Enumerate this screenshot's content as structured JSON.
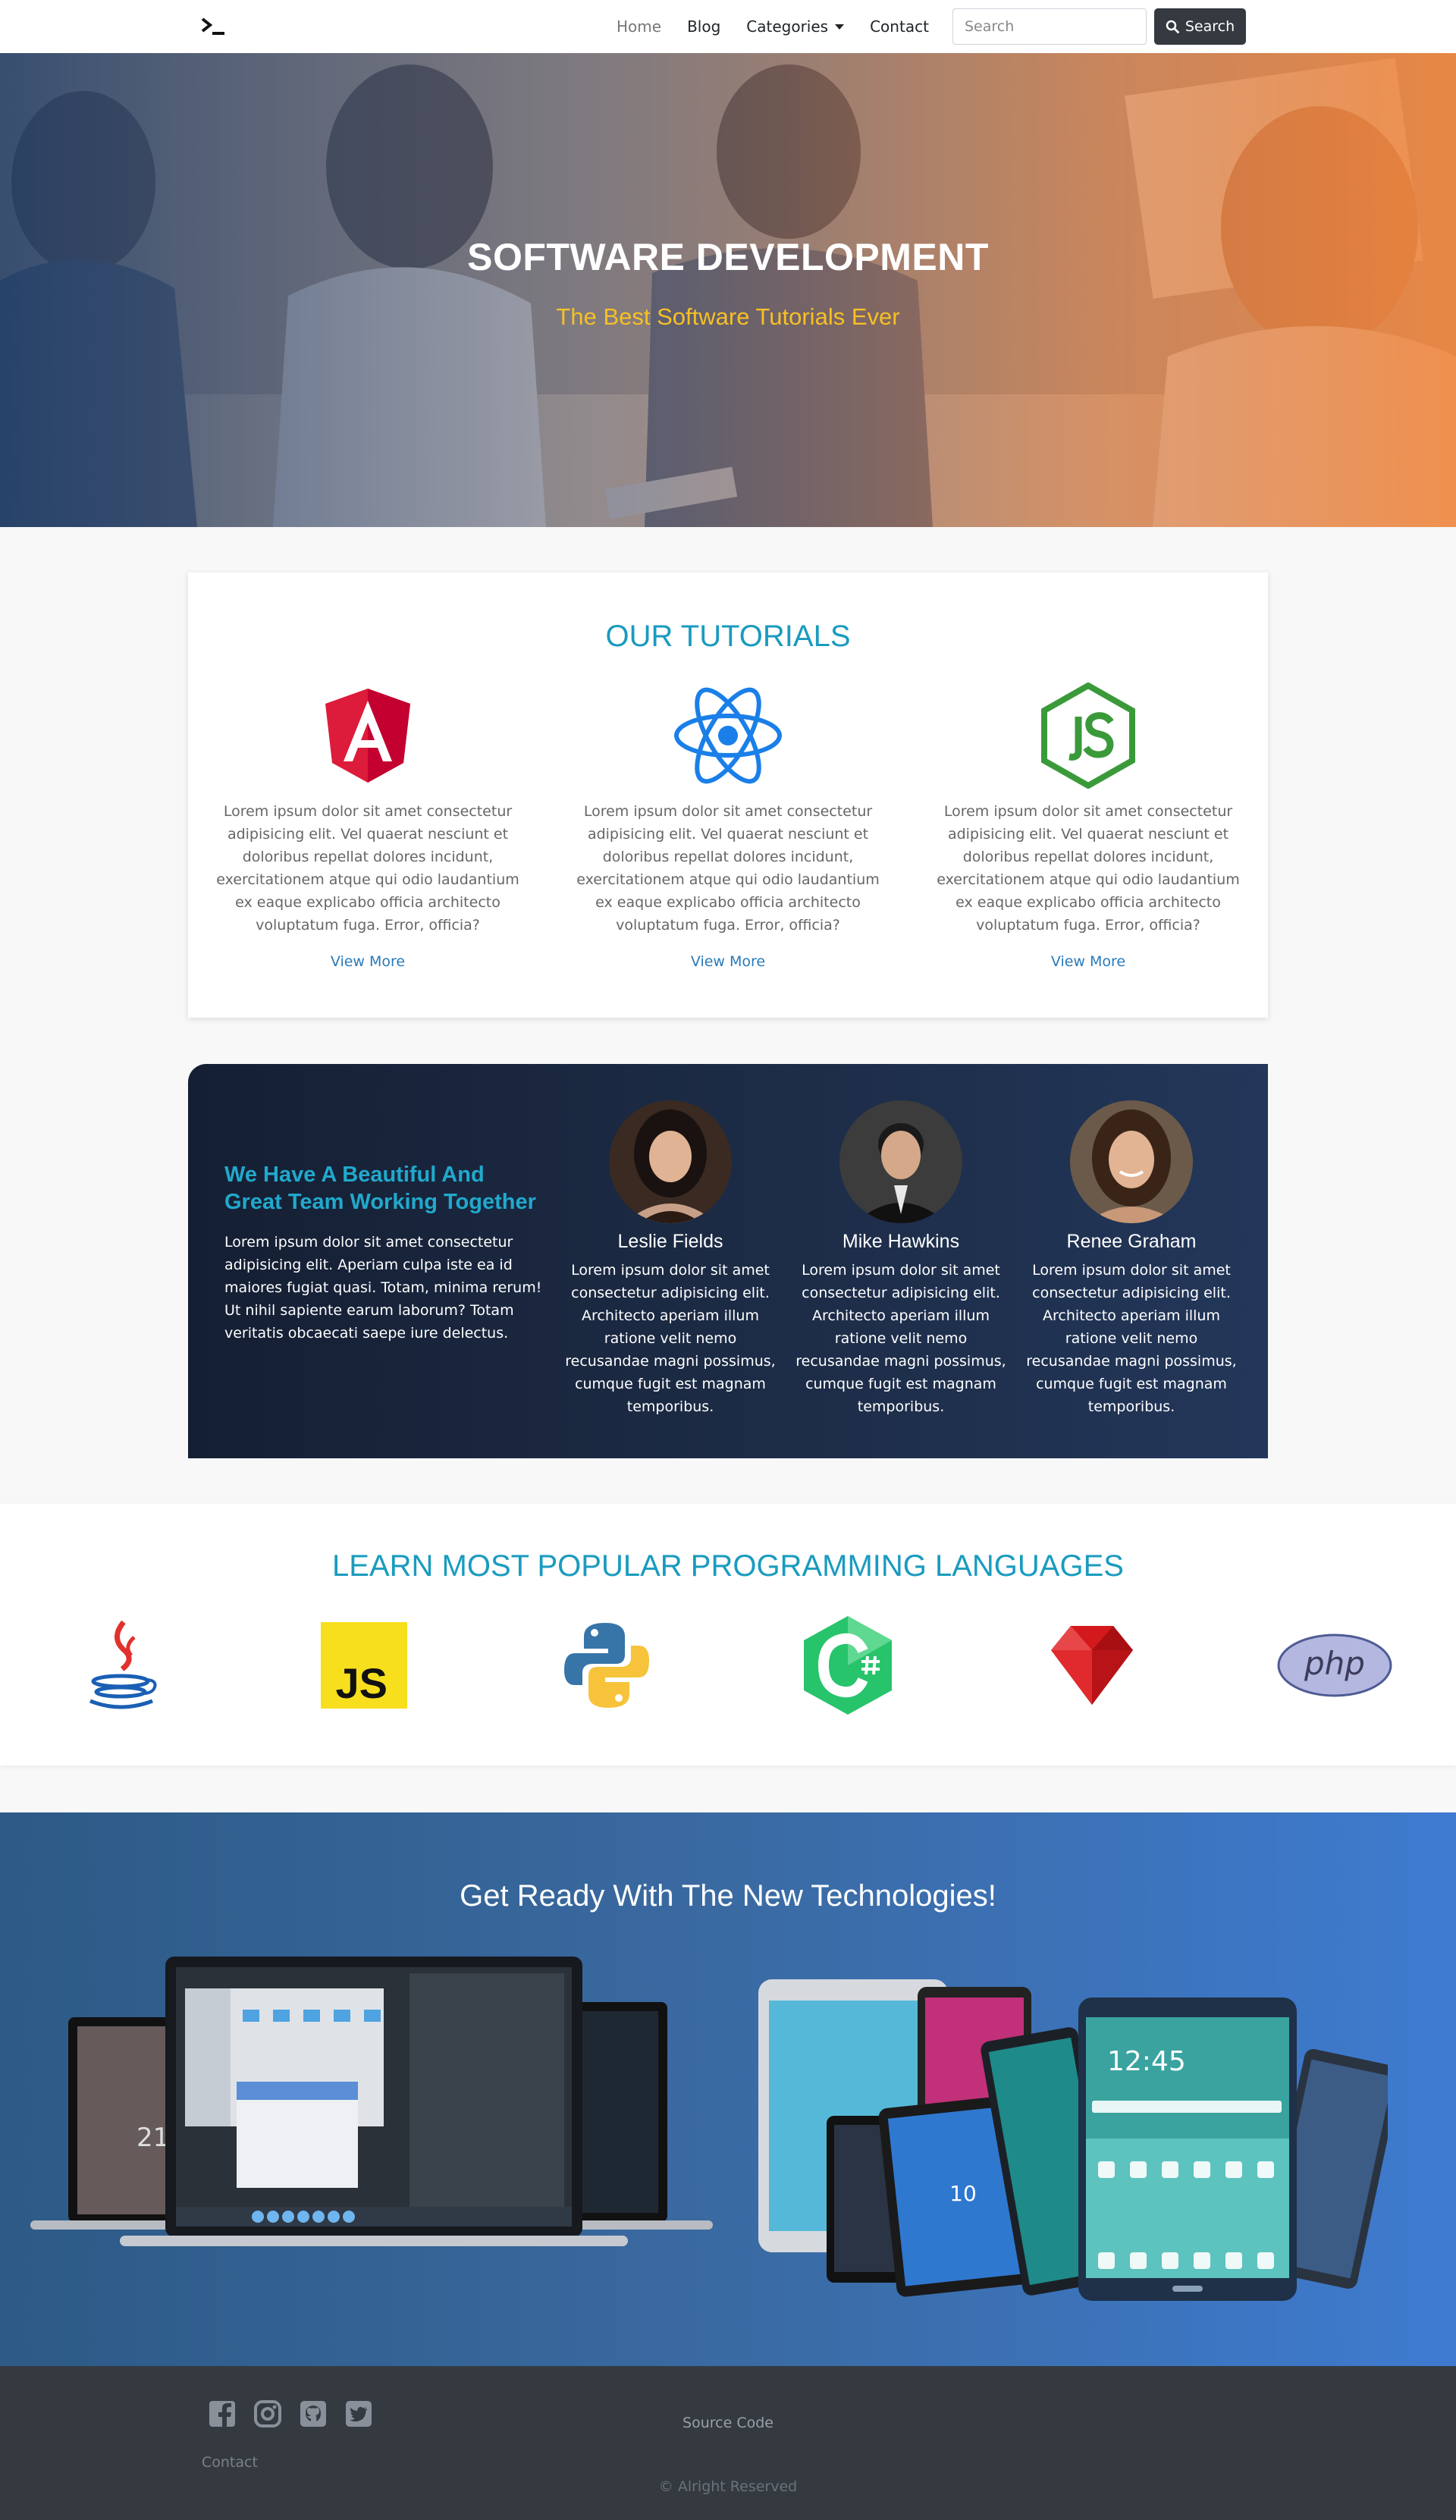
{
  "navbar": {
    "brand_icon": "terminal-icon",
    "links": [
      {
        "label": "Home",
        "active": true
      },
      {
        "label": "Blog"
      },
      {
        "label": "Categories",
        "dropdown": true
      },
      {
        "label": "Contact"
      }
    ],
    "search_placeholder": "Search",
    "search_button": "Search"
  },
  "hero": {
    "title": "SOFTWARE DEVELOPMENT",
    "subtitle": "The Best Software Tutorials Ever"
  },
  "tutorials": {
    "title": "OUR TUTORIALS",
    "items": [
      {
        "icon": "angular-icon",
        "text": "Lorem ipsum dolor sit amet consectetur adipisicing elit. Vel quaerat nesciunt et doloribus repellat dolores incidunt, exercitationem atque qui odio laudantium ex eaque explicabo officia architecto voluptatum fuga. Error, officia?",
        "link": "View More"
      },
      {
        "icon": "react-icon",
        "text": "Lorem ipsum dolor sit amet consectetur adipisicing elit. Vel quaerat nesciunt et doloribus repellat dolores incidunt, exercitationem atque qui odio laudantium ex eaque explicabo officia architecto voluptatum fuga. Error, officia?",
        "link": "View More"
      },
      {
        "icon": "nodejs-icon",
        "text": "Lorem ipsum dolor sit amet consectetur adipisicing elit. Vel quaerat nesciunt et doloribus repellat dolores incidunt, exercitationem atque qui odio laudantium ex eaque explicabo officia architecto voluptatum fuga. Error, officia?",
        "link": "View More"
      }
    ]
  },
  "team": {
    "heading": "We Have A Beautiful And Great Team Working Together",
    "text": "Lorem ipsum dolor sit amet consectetur adipisicing elit. Aperiam culpa iste ea id maiores fugiat quasi. Totam, minima rerum! Ut nihil sapiente earum laborum? Totam veritatis obcaecati saepe iure delectus.",
    "members": [
      {
        "name": "Leslie Fields",
        "text": "Lorem ipsum dolor sit amet consectetur adipisicing elit. Architecto aperiam illum ratione velit nemo recusandae magni possimus, cumque fugit est magnam temporibus."
      },
      {
        "name": "Mike Hawkins",
        "text": "Lorem ipsum dolor sit amet consectetur adipisicing elit. Architecto aperiam illum ratione velit nemo recusandae magni possimus, cumque fugit est magnam temporibus."
      },
      {
        "name": "Renee Graham",
        "text": "Lorem ipsum dolor sit amet consectetur adipisicing elit. Architecto aperiam illum ratione velit nemo recusandae magni possimus, cumque fugit est magnam temporibus."
      }
    ]
  },
  "languages": {
    "title": "LEARN MOST POPULAR PROGRAMMING LANGUAGES",
    "icons": [
      "java-icon",
      "javascript-icon",
      "python-icon",
      "csharp-icon",
      "ruby-icon",
      "php-icon"
    ],
    "js_text": "JS",
    "php_text": "php"
  },
  "tech": {
    "title": "Get Ready With The New Technologies!",
    "laptop_clock": "21",
    "tablet_clock": "12:45",
    "tablet_date": "10"
  },
  "footer": {
    "social_icons": [
      "facebook-icon",
      "instagram-icon",
      "github-icon",
      "twitter-icon"
    ],
    "contact": "Contact",
    "source": "Source Code",
    "copyright": "© Alright Reserved"
  },
  "colors": {
    "accent": "#1a9bbf",
    "hero_subtitle": "#f6c026",
    "team_heading": "#21a9cc",
    "footer_bg": "#353a41"
  }
}
